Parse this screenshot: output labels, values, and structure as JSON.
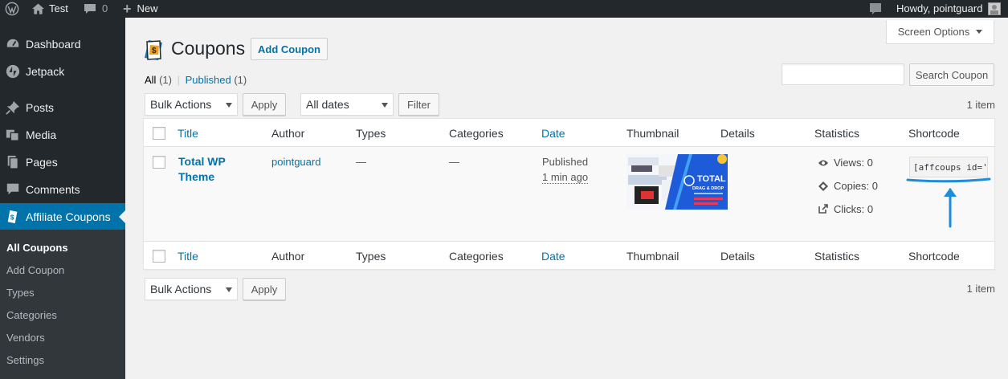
{
  "adminbar": {
    "site_name": "Test",
    "comments_count": "0",
    "new_label": "New",
    "howdy": "Howdy, pointguard"
  },
  "sidebar": {
    "items": [
      {
        "label": "Dashboard",
        "icon": "dashboard-icon"
      },
      {
        "label": "Jetpack",
        "icon": "jetpack-icon"
      },
      {
        "label": "Posts",
        "icon": "pin-icon"
      },
      {
        "label": "Media",
        "icon": "media-icon"
      },
      {
        "label": "Pages",
        "icon": "pages-icon"
      },
      {
        "label": "Comments",
        "icon": "comment-icon"
      },
      {
        "label": "Affiliate Coupons",
        "icon": "coupon-icon"
      }
    ],
    "submenu": [
      "All Coupons",
      "Add Coupon",
      "Types",
      "Categories",
      "Vendors",
      "Settings"
    ]
  },
  "header": {
    "screen_options": "Screen Options",
    "title": "Coupons",
    "add_new": "Add Coupon"
  },
  "views": {
    "all_label": "All",
    "all_count": "(1)",
    "separator": "|",
    "published_label": "Published",
    "published_count": "(1)"
  },
  "search": {
    "placeholder": "",
    "button": "Search Coupon"
  },
  "tablenav": {
    "bulk_actions": "Bulk Actions",
    "apply": "Apply",
    "all_dates": "All dates",
    "filter": "Filter",
    "items_count": "1 item"
  },
  "columns": [
    "Title",
    "Author",
    "Types",
    "Categories",
    "Date",
    "Thumbnail",
    "Details",
    "Statistics",
    "Shortcode"
  ],
  "row": {
    "title": "Total WP Theme",
    "author": "pointguard",
    "types": "—",
    "categories": "—",
    "status": "Published",
    "date": "1 min ago",
    "thumbnail_text": [
      "TOTAL",
      "DRAG & DROP"
    ],
    "stats": {
      "views": "Views: 0",
      "copies": "Copies: 0",
      "clicks": "Clicks: 0"
    },
    "shortcode": "[affcoups id='"
  },
  "colors": {
    "accent": "#0073aa",
    "sidebar_bg": "#23282d",
    "annotation": "#1e8cdc"
  }
}
